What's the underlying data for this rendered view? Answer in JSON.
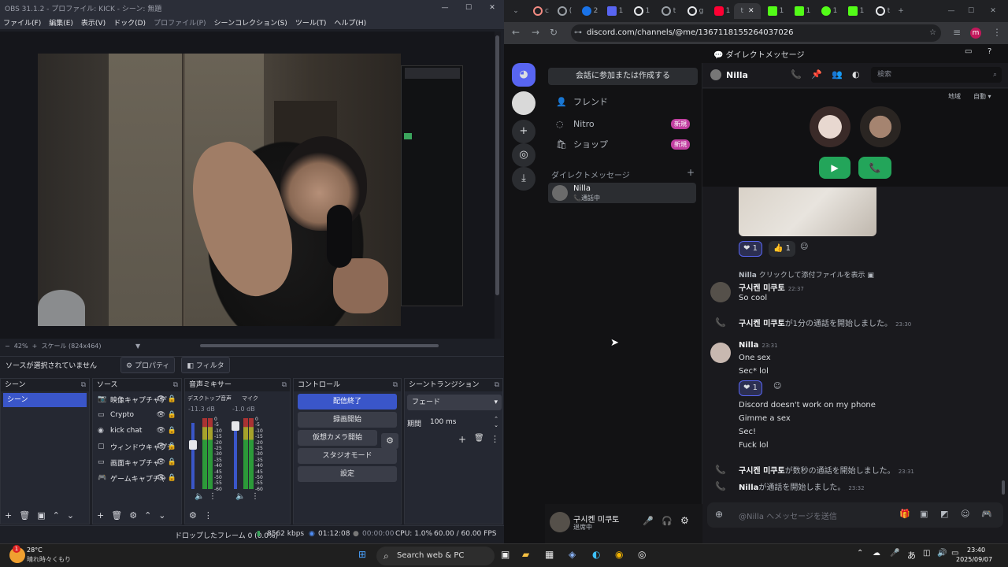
{
  "obs": {
    "title": "OBS 31.1.2 - プロファイル: KICK - シーン: 無題",
    "menu": [
      "ファイル(F)",
      "編集(E)",
      "表示(V)",
      "ドック(D)",
      "プロファイル(P)",
      "シーンコレクション(S)",
      "ツール(T)",
      "ヘルプ(H)"
    ],
    "zoom": "42%",
    "scale": "スケール (824x464)",
    "no_source": "ソースが選択されていません",
    "properties": "プロパティ",
    "filters": "フィルタ",
    "docks": {
      "scenes": "シーン",
      "sources": "ソース",
      "mixer": "音声ミキサー",
      "controls": "コントロール",
      "transitions": "シーントランジション"
    },
    "scene_item": "シーン",
    "sources": [
      "映像キャプチャデ",
      "Crypto",
      "kick chat",
      "ウィンドウキャプチ",
      "画面キャプチャ",
      "ゲームキャプチャ"
    ],
    "source_icons": [
      "camera-icon",
      "image-icon",
      "browser-icon",
      "window-icon",
      "monitor-icon",
      "gamepad-icon"
    ],
    "mixer": {
      "ch1_name": "デスクトップ音声",
      "ch1_db": "-11.3 dB",
      "ch2_name": "マイク",
      "ch2_db": "-1.0 dB",
      "scale": [
        "0",
        "-5",
        "-10",
        "-15",
        "-20",
        "-25",
        "-30",
        "-35",
        "-40",
        "-45",
        "-50",
        "-55",
        "-60"
      ]
    },
    "controls": [
      "配信終了",
      "録画開始",
      "仮想カメラ開始",
      "スタジオモード",
      "設定"
    ],
    "transition": {
      "type": "フェード",
      "duration_label": "期間",
      "duration": "100 ms"
    },
    "status": {
      "dropped": "ドロップしたフレーム 0 (0.0%)",
      "bitrate": "8562 kbps",
      "stream_time": "01:12:08",
      "rec_time": "00:00:00",
      "cpu": "CPU: 1.0%",
      "fps": "60.00 / 60.00 FPS"
    }
  },
  "chrome": {
    "url": "discord.com/channels/@me/1367118155264037026",
    "tabs": [
      "c",
      "(",
      "2",
      "1",
      "1",
      "t",
      "g",
      "1",
      "t",
      "1",
      "1",
      "1",
      "1",
      "t",
      "C",
      "t"
    ]
  },
  "discord": {
    "header": "ダイレクトメッセージ",
    "join_btn": "会話に参加または作成する",
    "nav": [
      {
        "label": "フレンド",
        "icon": "friends-icon"
      },
      {
        "label": "Nitro",
        "icon": "nitro-icon",
        "badge": "新規"
      },
      {
        "label": "ショップ",
        "icon": "shop-icon",
        "badge": "新規"
      }
    ],
    "dm_header": "ダイレクトメッセージ",
    "dm_plus": "+",
    "dm_item": {
      "name": "Nilla",
      "status": "通話中"
    },
    "user": {
      "name": "구시켄 미쿠토",
      "status": "退席中"
    },
    "channel_name": "Nilla",
    "search_placeholder": "検索",
    "region": "地域",
    "auto": "自動",
    "messages": {
      "reply_name": "Nilla",
      "reply_text": "クリックして添付ファイルを表示",
      "m1_name": "구시켄 미쿠토",
      "m1_time": "22:37",
      "m1_text": "So cool",
      "sys1_name": "구시켄 미쿠토",
      "sys1_text": "が1分の通話を開始しました。",
      "sys1_time": "23:30",
      "m2_name": "Nilla",
      "m2_time": "23:31",
      "m2_lines": [
        "One sex",
        "Sec* lol"
      ],
      "m2_lines2": [
        "Discord doesn't work on my phone",
        "Gimme a sex",
        "Sec!",
        "Fuck lol"
      ],
      "sys2_name": "구시켄 미쿠토",
      "sys2_text": "が数秒の通話を開始しました。",
      "sys2_time": "23:31",
      "sys3_name": "Nilla",
      "sys3_text": "が通話を開始しました。",
      "sys3_time": "23:32",
      "reacts": [
        "1",
        "1",
        "1"
      ]
    },
    "input_placeholder": "@Nilla へメッセージを送信"
  },
  "taskbar": {
    "weather_temp": "28°C",
    "weather_desc": "晴れ時々くもり",
    "weather_badge": "1",
    "search": "Search web & PC",
    "ime": "あ",
    "time": "23:40",
    "date": "2025/09/07"
  },
  "colors": {
    "obs_accent": "#3a56c9",
    "discord_green": "#23a55a",
    "nitro_badge": "#c13fa0"
  }
}
